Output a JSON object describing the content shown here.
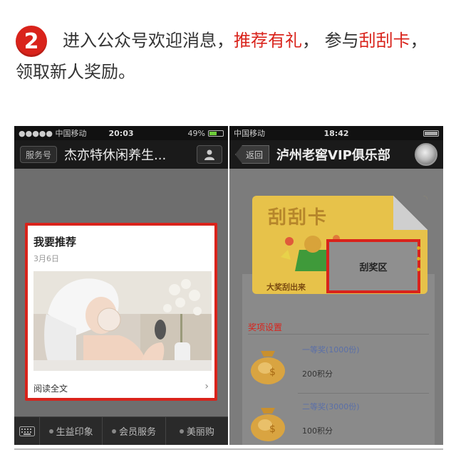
{
  "step": {
    "number": "2",
    "line1_prefix": "进入公众号欢迎消息，",
    "line1_highlight1": "推荐有礼",
    "line1_middle": "，  参与",
    "line1_highlight2": "刮刮卡",
    "line1_suffix": "，",
    "line2": "领取新人奖励。"
  },
  "left_phone": {
    "status": {
      "carrier": "●●●●● 中国移动",
      "time": "20:03",
      "battery_pct": "49%"
    },
    "nav": {
      "pill": "服务号",
      "title": "杰亦特休闲养生..."
    },
    "card": {
      "title": "我要推荐",
      "date": "3月6日",
      "read_more": "阅读全文"
    },
    "menu": [
      "生益印象",
      "会员服务",
      "美丽购"
    ]
  },
  "right_phone": {
    "status": {
      "carrier": "中国移动",
      "time": "18:42"
    },
    "nav": {
      "back": "返回",
      "title": "泸州老窖VIP俱乐部"
    },
    "scratch": {
      "title": "刮刮卡",
      "subtitle": "大奖刮出来",
      "prize_area": "刮奖区"
    },
    "prizes": {
      "header": "奖项设置",
      "items": [
        {
          "name": "一等奖(1000份)",
          "points": "200积分"
        },
        {
          "name": "二等奖(3000份)",
          "points": "100积分"
        }
      ]
    }
  },
  "colors": {
    "accent": "#d9231b"
  }
}
